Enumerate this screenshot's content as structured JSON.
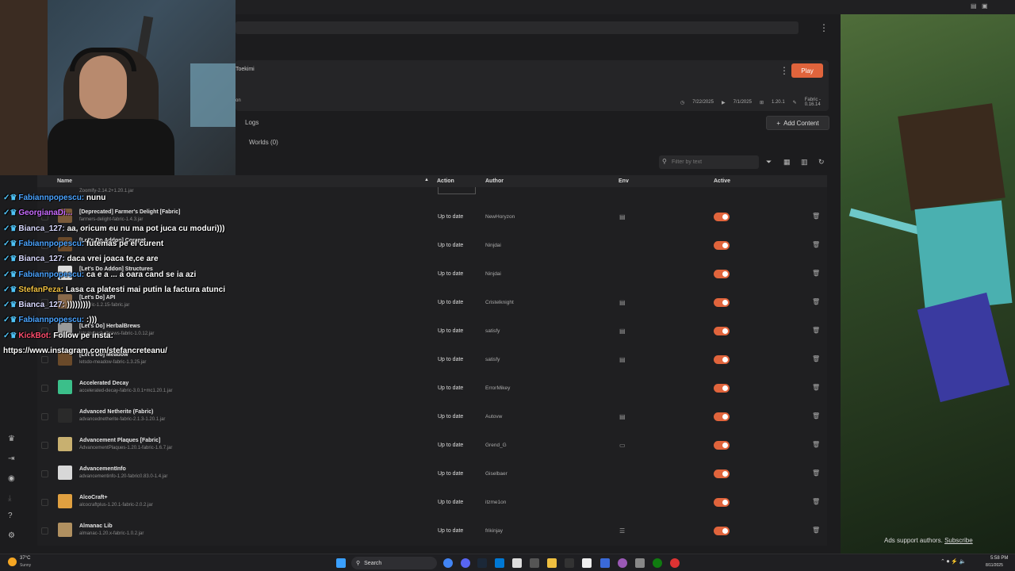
{
  "instance": {
    "author": "Toekimi",
    "play_label": "Play",
    "meta": {
      "modified": "7/22/2025",
      "played": "7/1/2025",
      "version": "1.20.1",
      "loader": "Fabric - 0.16.14"
    },
    "subtitle_fragment": "on"
  },
  "tabs": {
    "logs": "Logs",
    "worlds": "Worlds (0)"
  },
  "add_content_label": "Add Content",
  "filter_placeholder": "Filter by text",
  "table": {
    "headers": {
      "name": "Name",
      "action": "Action",
      "author": "Author",
      "env": "Env",
      "active": "Active"
    },
    "partial_top_file": "Zoomify-2.14.2+1.20.1.jar",
    "rows": [
      {
        "title": "[Deprecated] Farmer's Delight [Fabric]",
        "file": "farmers-delight-fabric-1.4.3.jar",
        "action": "Up to date",
        "author": "NewHoryzon",
        "env": "server",
        "thumb": "#7a5a3a"
      },
      {
        "title": "[Let's Do Addon] Compat",
        "file": "",
        "action": "Up to date",
        "author": "Ninjdai",
        "env": "",
        "thumb": "#6b4a2a"
      },
      {
        "title": "[Let's Do Addon] Structures",
        "file": "",
        "action": "Up to date",
        "author": "Ninjdai",
        "env": "",
        "thumb": "#dddddd"
      },
      {
        "title": "[Let's Do] API",
        "file": "...fabric-1.2.15-fabric.jar",
        "action": "Up to date",
        "author": "Cristelknight",
        "env": "server",
        "thumb": "#8a6a4a"
      },
      {
        "title": "[Let's Do] HerbalBrews",
        "file": "letsdo-herbalbrews-fabric-1.0.12.jar",
        "action": "Up to date",
        "author": "satisfy",
        "env": "server",
        "thumb": "#9a9a9a"
      },
      {
        "title": "[Let's Do] Meadow",
        "file": "letsdo-meadow-fabric-1.3.25.jar",
        "action": "Up to date",
        "author": "satisfy",
        "env": "server",
        "thumb": "#6a4a2a"
      },
      {
        "title": "Accelerated Decay",
        "file": "accelerated-decay-fabric-3.0.1+mc1.20.1.jar",
        "action": "Up to date",
        "author": "ErrorMikey",
        "env": "",
        "thumb": "#3bbf8a"
      },
      {
        "title": "Advanced Netherite (Fabric)",
        "file": "advancednetherite-fabric-2.1.3-1.20.1.jar",
        "action": "Up to date",
        "author": "Autovw",
        "env": "server",
        "thumb": "#2a2a2a"
      },
      {
        "title": "Advancement Plaques [Fabric]",
        "file": "AdvancementPlaques-1.20.1-fabric-1.6.7.jar",
        "action": "Up to date",
        "author": "Grend_G",
        "env": "client",
        "thumb": "#c8b070"
      },
      {
        "title": "AdvancementInfo",
        "file": "advancementinfo-1.20-fabric0.83.0-1.4.jar",
        "action": "Up to date",
        "author": "Giselbaer",
        "env": "",
        "thumb": "#d8d8d8"
      },
      {
        "title": "AlcoCraft+",
        "file": "alcocraftplus-1.20.1-fabric-2.0.2.jar",
        "action": "Up to date",
        "author": "itzme1on",
        "env": "",
        "thumb": "#e0a040"
      },
      {
        "title": "Almanac Lib",
        "file": "almanac-1.20.x-fabric-1.0.2.jar",
        "action": "Up to date",
        "author": "frikinjay",
        "env": "both",
        "thumb": "#b09060"
      }
    ]
  },
  "chat": [
    {
      "user": "Fabiannpopescu:",
      "color": "#4aa3ff",
      "msg": "nunu"
    },
    {
      "user": "GeorgianaDi...",
      "color": "#c86bff",
      "msg": ""
    },
    {
      "user": "Bianca_127:",
      "color": "#d9d9ff",
      "msg": "aa, oricum eu nu ma pot juca cu moduri)))"
    },
    {
      "user": "Fabiannpopescu:",
      "color": "#4aa3ff",
      "msg": "futemas pe el curent"
    },
    {
      "user": "Bianca_127:",
      "color": "#d9d9ff",
      "msg": "daca vrei joaca te,ce are"
    },
    {
      "user": "Fabiannpopescu:",
      "color": "#4aa3ff",
      "msg": "ca e a ... a oara cand se ia azi"
    },
    {
      "user": "StefanPeza:",
      "color": "#f0c040",
      "msg": "Lasa ca platesti mai putin la factura atunci"
    },
    {
      "user": "Bianca_127:",
      "color": "#d9d9ff",
      "msg": ")))))))))"
    },
    {
      "user": "Fabiannpopescu:",
      "color": "#4aa3ff",
      "msg": ":)))"
    },
    {
      "user": "KickBot:",
      "color": "#ff4d6d",
      "msg": "Follow pe insta:"
    },
    {
      "user": "",
      "color": "#ffffff",
      "msg": "https://www.instagram.com/stefancreteanu/"
    }
  ],
  "ads": {
    "text": "Ads support authors.",
    "link": "Subscribe"
  },
  "taskbar": {
    "search_label": "Search",
    "weather_temp": "37°C",
    "weather_desc": "Sunny",
    "time": "5:58 PM",
    "date": "8/11/2025"
  }
}
